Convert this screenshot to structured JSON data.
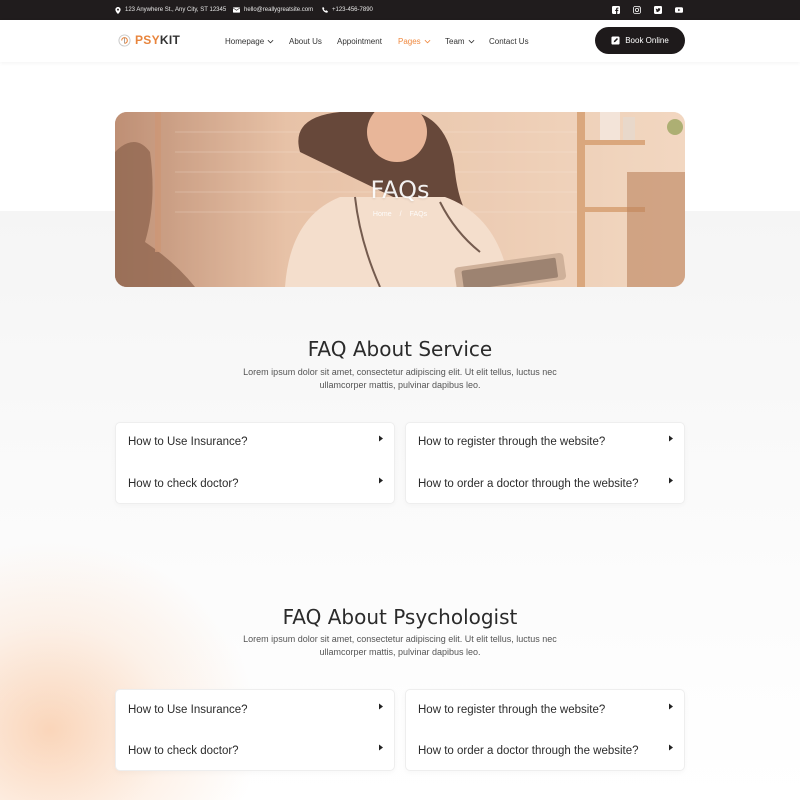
{
  "topbar": {
    "address": "123 Anywhere St., Any City, ST 12345",
    "email": "hello@reallygreatsite.com",
    "phone": "+123-456-7890",
    "social": [
      "facebook-icon",
      "instagram-icon",
      "twitter-icon",
      "youtube-icon"
    ]
  },
  "nav": {
    "logo_part1": "PSY",
    "logo_part2": "KIT",
    "items": [
      {
        "label": "Homepage",
        "dropdown": true
      },
      {
        "label": "About Us",
        "dropdown": false
      },
      {
        "label": "Appointment",
        "dropdown": false
      },
      {
        "label": "Pages",
        "dropdown": true,
        "active": true
      },
      {
        "label": "Team",
        "dropdown": true
      },
      {
        "label": "Contact Us",
        "dropdown": false
      }
    ],
    "cta": "Book Online"
  },
  "hero": {
    "title": "FAQs",
    "breadcrumb_home": "Home",
    "breadcrumb_sep": "/",
    "breadcrumb_current": "FAQs"
  },
  "sections": [
    {
      "title": "FAQ About Service",
      "subtitle": "Lorem ipsum dolor sit amet, consectetur adipiscing elit. Ut elit tellus, luctus nec ullamcorper mattis, pulvinar dapibus leo.",
      "left": [
        "How to Use Insurance?",
        "How to check doctor?"
      ],
      "right": [
        "How to register through the website?",
        "How to order a doctor through the website?"
      ]
    },
    {
      "title": "FAQ About Psychologist",
      "subtitle": "Lorem ipsum dolor sit amet, consectetur adipiscing elit. Ut elit tellus, luctus nec ullamcorper mattis, pulvinar dapibus leo.",
      "left": [
        "How to Use Insurance?",
        "How to check doctor?"
      ],
      "right": [
        "How to register through the website?",
        "How to order a doctor through the website?"
      ]
    }
  ],
  "colors": {
    "accent": "#f0893f",
    "dark": "#1e1a1b"
  }
}
